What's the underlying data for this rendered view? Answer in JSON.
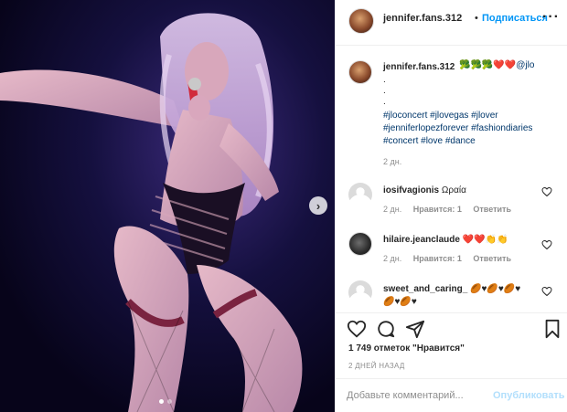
{
  "header": {
    "username": "jennifer.fans.312",
    "separator": "•",
    "follow_label": "Подписаться",
    "more_label": "···"
  },
  "caption": {
    "username": "jennifer.fans.312",
    "emojis": "🥦🥦🥦❤️❤️",
    "mention": "@jlo",
    "periods": ".\n.\n.",
    "hashtags": "#jloconcert #jlovegas #jlover #jenniferlopezforever #fashiondiaries #concert #love #dance",
    "time": "2 дн."
  },
  "comments": [
    {
      "username": "iosifvagionis",
      "text": "Ωραία",
      "time": "2 дн.",
      "likes": "Нравится: 1",
      "reply": "Ответить",
      "avatar": "default-avatar"
    },
    {
      "username": "hilaire.jeanclaude",
      "text": "❤️❤️👏👏",
      "time": "2 дн.",
      "likes": "Нравится: 1",
      "reply": "Ответить",
      "avatar": "photo-avatar"
    },
    {
      "username": "sweet_and_caring_",
      "text": "🏉♥🏉♥🏉♥🏉♥🏉♥",
      "avatar": "default-avatar"
    }
  ],
  "actions": {
    "like": "heart-icon",
    "comment": "comment-icon",
    "share": "share-icon",
    "save": "bookmark-icon"
  },
  "likes_text": "1 749 отметок \"Нравится\"",
  "date_text": "2 ДНЕЙ НАЗАД",
  "add_comment": {
    "placeholder": "Добавьте комментарий...",
    "publish_label": "Опубликовать"
  },
  "carousel": {
    "current": 1,
    "total": 2
  },
  "colors": {
    "link": "#0095f6",
    "hashtag": "#00376b",
    "muted": "#8e8e8e",
    "publish_disabled": "#b2dffc"
  }
}
